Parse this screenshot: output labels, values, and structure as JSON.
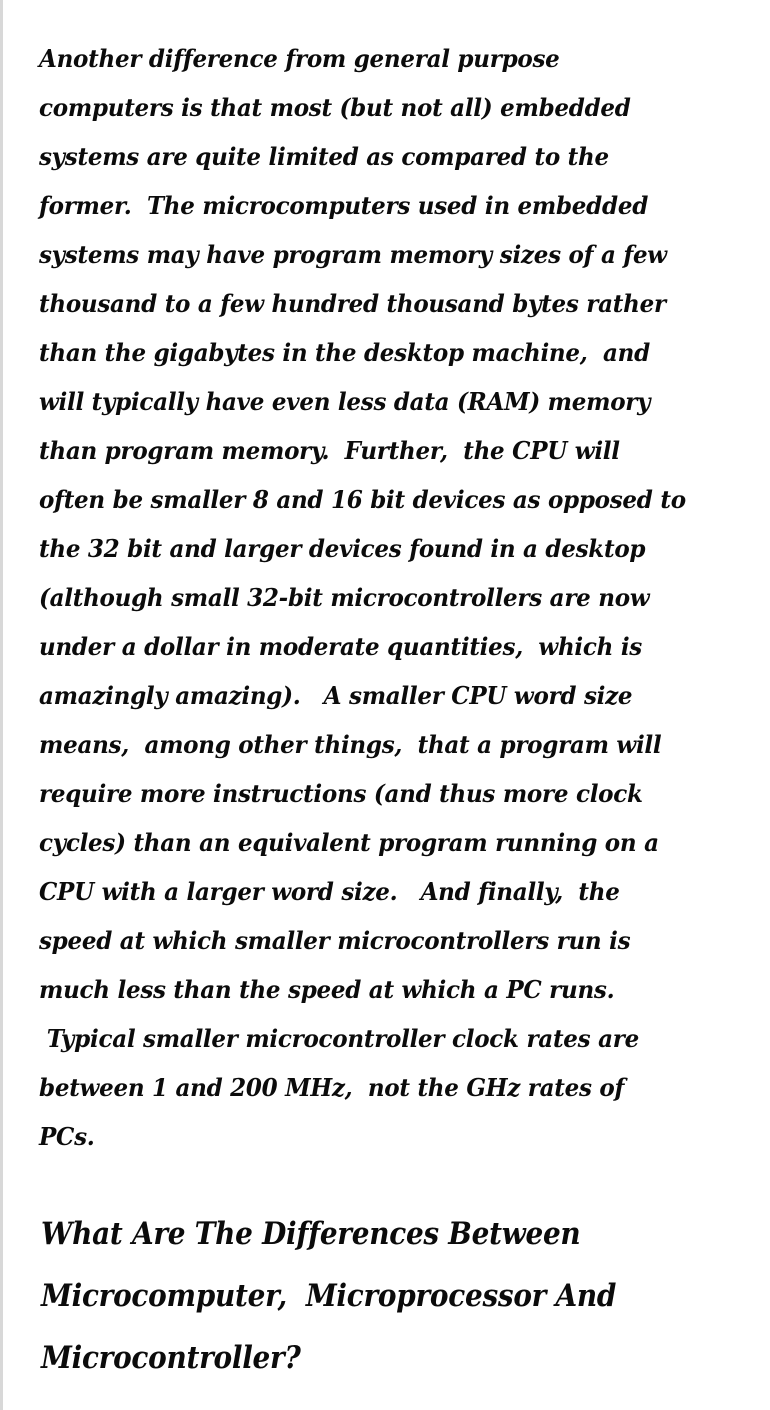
{
  "article": {
    "paragraph_lines": [
      "Another difference from general purpose",
      "computers is that most (but not all) embedded",
      "systems are quite limited as compared to the",
      "former.  The microcomputers used in embedded",
      "systems may have program memory sizes of a few",
      "thousand to a few hundred thousand bytes rather",
      "than the gigabytes in the desktop machine,  and",
      "will typically have even less data (RAM) memory",
      "than program memory.  Further,  the CPU will",
      "often be smaller 8 and 16 bit devices as opposed to",
      "the 32 bit and larger devices found in a desktop",
      "(although small 32-bit microcontrollers are now",
      "under a dollar in moderate quantities,  which is",
      "amazingly amazing).   A smaller CPU word size",
      "means,  among other things,  that a program will",
      "require more instructions (and thus more clock",
      "cycles) than an equivalent program running on a",
      "CPU with a larger word size.   And finally,  the",
      "speed at which smaller microcontrollers run is",
      "much less than the speed at which a PC runs.",
      " Typical smaller microcontroller clock rates are",
      "between 1 and 200 MHz,  not the GHz rates of",
      "PCs."
    ],
    "heading_lines": [
      "What Are The Differences Between",
      "Microcomputer,  Microprocessor And",
      "Microcontroller?"
    ]
  }
}
